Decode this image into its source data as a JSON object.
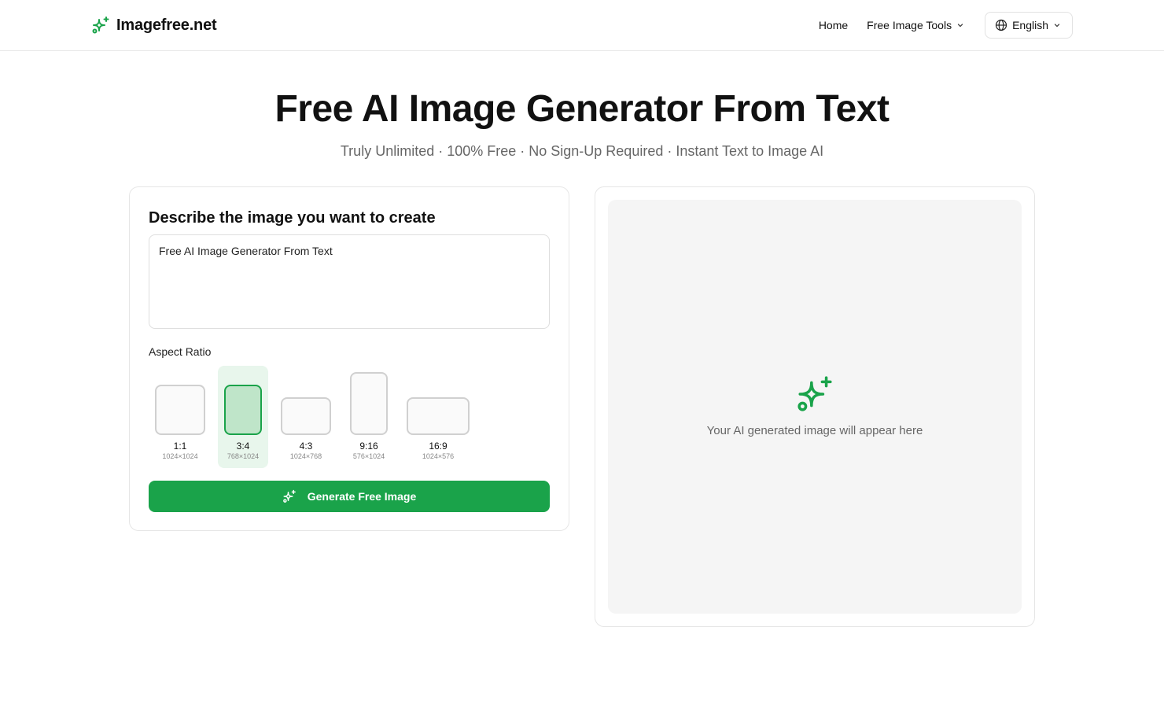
{
  "brand": {
    "name": "Imagefree.net",
    "icon": "sparkles-icon",
    "accent_color": "#1aa34a"
  },
  "nav": {
    "home_label": "Home",
    "tools_label": "Free Image Tools",
    "language_label": "English"
  },
  "hero": {
    "title": "Free AI Image Generator From Text",
    "subtitle": "Truly Unlimited · 100% Free · No Sign-Up Required · Instant Text to Image AI"
  },
  "form": {
    "heading": "Describe the image you want to create",
    "prompt_value": "Free AI Image Generator From Text",
    "aspect_label": "Aspect Ratio",
    "ratios": [
      {
        "label": "1:1",
        "size": "1024×1024"
      },
      {
        "label": "3:4",
        "size": "768×1024"
      },
      {
        "label": "4:3",
        "size": "1024×768"
      },
      {
        "label": "9:16",
        "size": "576×1024"
      },
      {
        "label": "16:9",
        "size": "1024×576"
      }
    ],
    "selected_ratio": "3:4",
    "generate_label": "Generate Free Image"
  },
  "preview": {
    "placeholder_text": "Your AI generated image will appear here"
  }
}
